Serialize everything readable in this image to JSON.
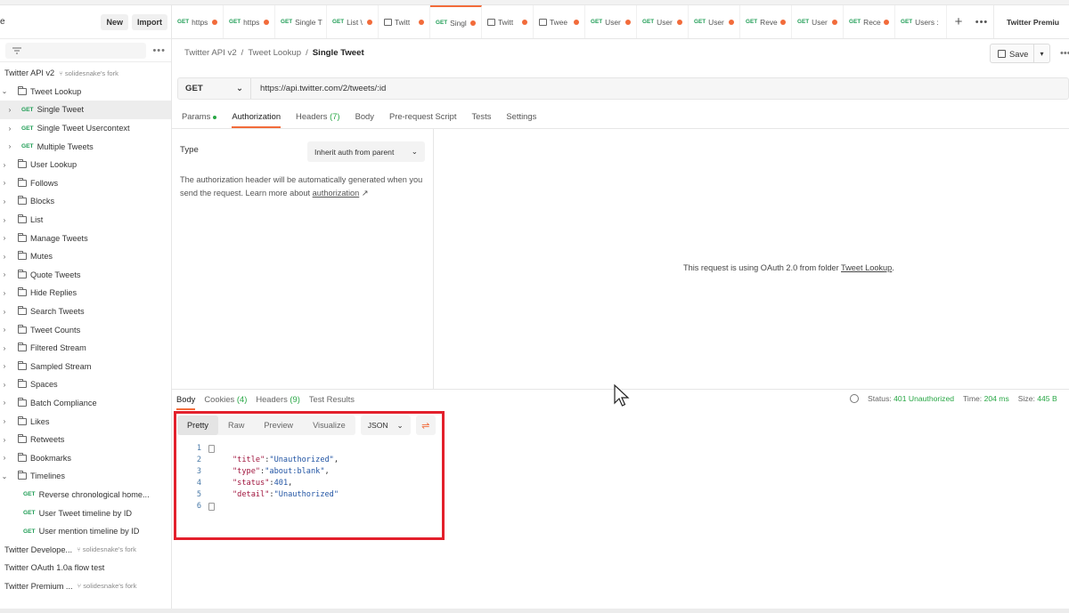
{
  "sidebar": {
    "header_cut": "e",
    "new_label": "New",
    "import_label": "Import",
    "more": "•••",
    "collections": [
      {
        "name": "Twitter API v2",
        "fork": "solidesnake's fork"
      }
    ],
    "tree": [
      {
        "type": "folder",
        "label": "Tweet Lookup",
        "open": true,
        "level": 0
      },
      {
        "type": "request",
        "method": "GET",
        "label": "Single Tweet",
        "level": 1,
        "selected": true
      },
      {
        "type": "request",
        "method": "GET",
        "label": "Single Tweet Usercontext",
        "level": 1
      },
      {
        "type": "request",
        "method": "GET",
        "label": "Multiple Tweets",
        "level": 1
      },
      {
        "type": "folder",
        "label": "User Lookup",
        "level": 0
      },
      {
        "type": "folder",
        "label": "Follows",
        "level": 0
      },
      {
        "type": "folder",
        "label": "Blocks",
        "level": 0
      },
      {
        "type": "folder",
        "label": "List",
        "level": 0
      },
      {
        "type": "folder",
        "label": "Manage Tweets",
        "level": 0
      },
      {
        "type": "folder",
        "label": "Mutes",
        "level": 0
      },
      {
        "type": "folder",
        "label": "Quote Tweets",
        "level": 0
      },
      {
        "type": "folder",
        "label": "Hide Replies",
        "level": 0
      },
      {
        "type": "folder",
        "label": "Search Tweets",
        "level": 0
      },
      {
        "type": "folder",
        "label": "Tweet Counts",
        "level": 0
      },
      {
        "type": "folder",
        "label": "Filtered Stream",
        "level": 0
      },
      {
        "type": "folder",
        "label": "Sampled Stream",
        "level": 0
      },
      {
        "type": "folder",
        "label": "Spaces",
        "level": 0
      },
      {
        "type": "folder",
        "label": "Batch Compliance",
        "level": 0
      },
      {
        "type": "folder",
        "label": "Likes",
        "level": 0
      },
      {
        "type": "folder",
        "label": "Retweets",
        "level": 0
      },
      {
        "type": "folder",
        "label": "Bookmarks",
        "level": 0
      },
      {
        "type": "folder",
        "label": "Timelines",
        "open": true,
        "level": 0
      },
      {
        "type": "request",
        "method": "GET",
        "label": "Reverse chronological home...",
        "level": 2
      },
      {
        "type": "request",
        "method": "GET",
        "label": "User Tweet timeline by ID",
        "level": 2
      },
      {
        "type": "request",
        "method": "GET",
        "label": "User mention timeline by ID",
        "level": 2
      }
    ],
    "other_collections": [
      {
        "name": "Twitter Develope...",
        "fork": "solidesnake's fork"
      },
      {
        "name": "Twitter OAuth 1.0a flow test",
        "fork": ""
      },
      {
        "name": "Twitter Premium ...",
        "fork": "solidesnake's fork"
      }
    ]
  },
  "tabs": [
    {
      "method": "GET",
      "label": "https",
      "dot": true
    },
    {
      "method": "GET",
      "label": "https",
      "dot": true
    },
    {
      "method": "GET",
      "label": "Single T",
      "dot": false
    },
    {
      "method": "GET",
      "label": "List \\",
      "dot": true
    },
    {
      "icon": "folder",
      "label": "Twitt",
      "dot": true
    },
    {
      "method": "GET",
      "label": "Singl",
      "dot": true,
      "active": true
    },
    {
      "icon": "flow",
      "label": "Twitt",
      "dot": true
    },
    {
      "icon": "folder",
      "label": "Twee",
      "dot": true
    },
    {
      "method": "GET",
      "label": "User",
      "dot": true
    },
    {
      "method": "GET",
      "label": "User",
      "dot": true
    },
    {
      "method": "GET",
      "label": "User",
      "dot": true
    },
    {
      "method": "GET",
      "label": "Reve",
      "dot": true
    },
    {
      "method": "GET",
      "label": "User",
      "dot": true
    },
    {
      "method": "GET",
      "label": "Rece",
      "dot": true
    },
    {
      "method": "GET",
      "label": "Users :",
      "dot": false
    }
  ],
  "tab_plus": "+",
  "tab_more": "•••",
  "environment": "Twitter Premiu",
  "breadcrumb": {
    "part1": "Twitter API v2",
    "sep": "/",
    "part2": "Tweet Lookup",
    "current": "Single Tweet"
  },
  "save_label": "Save",
  "request": {
    "method": "GET",
    "url": "https://api.twitter.com/2/tweets/:id"
  },
  "req_tabs": {
    "params": "Params",
    "authorization": "Authorization",
    "headers": "Headers",
    "headers_count": "(7)",
    "body": "Body",
    "prerequest": "Pre-request Script",
    "tests": "Tests",
    "settings": "Settings"
  },
  "auth": {
    "type_label": "Type",
    "type_value": "Inherit auth from parent",
    "desc_pre": "The authorization header will be automatically generated when you send the request. Learn more about ",
    "desc_link": "authorization",
    "desc_arrow": "↗",
    "msg_pre": "This request is using OAuth 2.0 from folder ",
    "msg_link": "Tweet Lookup",
    "msg_post": "."
  },
  "response": {
    "tabs": {
      "body": "Body",
      "cookies": "Cookies",
      "cookies_count": "(4)",
      "headers": "Headers",
      "headers_count": "(9)",
      "test_results": "Test Results"
    },
    "status_label": "Status:",
    "status_value": "401 Unauthorized",
    "time_label": "Time:",
    "time_value": "204 ms",
    "size_label": "Size:",
    "size_value": "445 B",
    "views": {
      "pretty": "Pretty",
      "raw": "Raw",
      "preview": "Preview",
      "visualize": "Visualize"
    },
    "format": "JSON",
    "code_lines": [
      {
        "n": "1",
        "text": "{"
      },
      {
        "n": "2",
        "key": "\"title\"",
        "val": "\"Unauthorized\"",
        "end": ","
      },
      {
        "n": "3",
        "key": "\"type\"",
        "val": "\"about:blank\"",
        "end": ","
      },
      {
        "n": "4",
        "key": "\"status\"",
        "val": "401",
        "end": ","
      },
      {
        "n": "5",
        "key": "\"detail\"",
        "val": "\"Unauthorized\"",
        "end": ""
      },
      {
        "n": "6",
        "text": "}"
      }
    ]
  },
  "colors": {
    "accent": "#f26b3a",
    "get": "#1f9d55",
    "highlight": "#e3202c",
    "ok": "#28a745"
  }
}
